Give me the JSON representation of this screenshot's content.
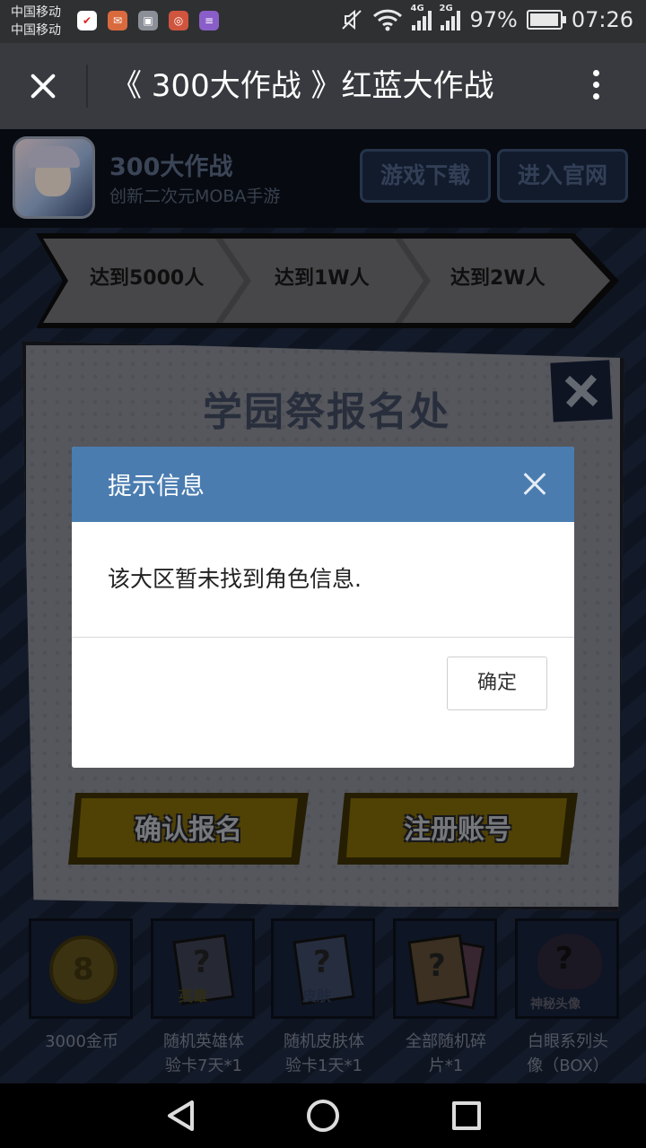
{
  "status_bar": {
    "carrier_1": "中国移动",
    "carrier_2": "中国移动",
    "network_1": "4G",
    "network_2": "2G",
    "battery": "97%",
    "time": "07:26"
  },
  "title_bar": {
    "title": "《 300大作战 》红蓝大作战"
  },
  "game_header": {
    "name": "300大作战",
    "subtitle": "创新二次元MOBA手游",
    "download_label": "游戏下载",
    "official_label": "进入官网"
  },
  "progress": {
    "steps": [
      "达到5000人",
      "达到1W人",
      "达到2W人"
    ]
  },
  "registration": {
    "title": "学园祭报名处",
    "confirm_label": "确认报名",
    "register_label": "注册账号"
  },
  "rewards": [
    {
      "label": "3000金币",
      "icon": "gold-coin-icon"
    },
    {
      "label": "随机英雄体\n验卡7天*1",
      "icon": "hero-card-icon",
      "card_text": "英雄"
    },
    {
      "label": "随机皮肤体\n验卡1天*1",
      "icon": "skin-card-icon",
      "card_text": "皮肤"
    },
    {
      "label": "全部随机碎\n片*1",
      "icon": "fragment-cards-icon"
    },
    {
      "label": "白眼系列头\n像（BOX）",
      "icon": "mystery-avatar-icon",
      "card_text": "神秘头像"
    }
  ],
  "dialog": {
    "title": "提示信息",
    "message": "该大区暂未找到角色信息.",
    "ok_label": "确定"
  },
  "colors": {
    "dialog_header": "#4a7cb0",
    "title_bar": "#393a3f",
    "status_bar": "#2f3032"
  }
}
